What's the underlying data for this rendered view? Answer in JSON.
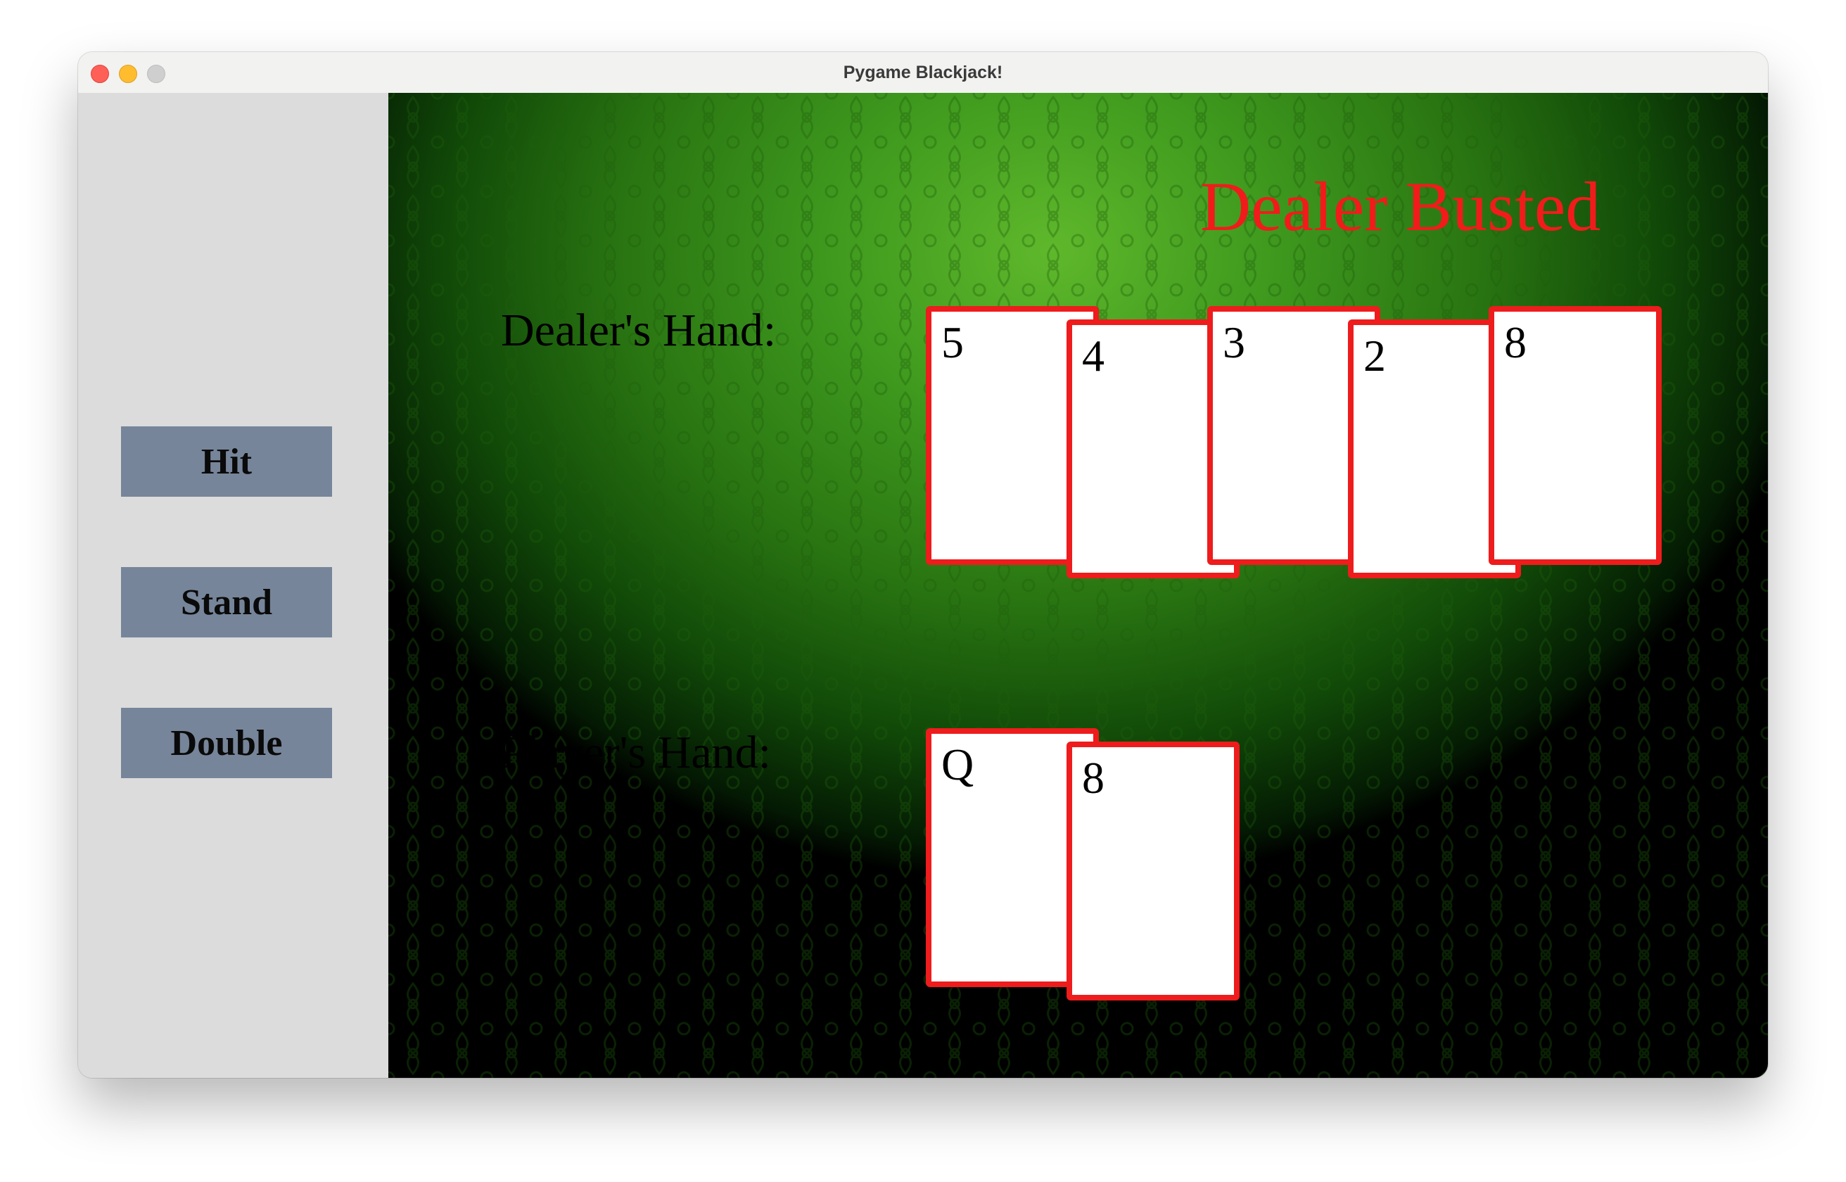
{
  "window": {
    "title": "Pygame Blackjack!"
  },
  "sidebar": {
    "buttons": [
      {
        "label": "Hit"
      },
      {
        "label": "Stand"
      },
      {
        "label": "Double"
      }
    ]
  },
  "table": {
    "status": "Dealer Busted",
    "dealer_label": "Dealer's Hand:",
    "player_label": "Player's Hand:",
    "dealer_cards": [
      "5",
      "4",
      "3",
      "2",
      "8"
    ],
    "player_cards": [
      "Q",
      "8"
    ]
  },
  "colors": {
    "felt": "#3f9a1e",
    "card_border": "#ee1c1c",
    "status_text": "#f21b1b",
    "button_bg": "#768599",
    "sidebar_bg": "#dcdcdd"
  }
}
